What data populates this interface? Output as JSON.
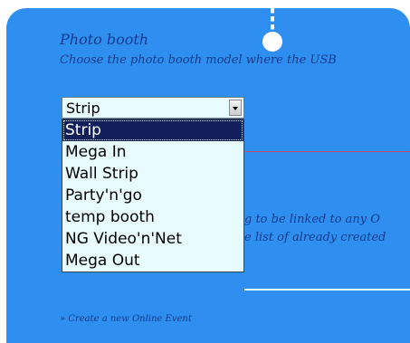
{
  "section": {
    "title": "Photo booth",
    "description": "Choose the photo booth model where the USB"
  },
  "model_select": {
    "value": "Strip",
    "options": [
      "Strip",
      "Mega In",
      "Wall Strip",
      "Party'n'go",
      "temp booth",
      "NG Video'n'Net",
      "Mega Out"
    ],
    "selected_index": 0
  },
  "background_text": {
    "line1": "g to be linked to any O",
    "line2": "e list of already created"
  },
  "create_link": "» Create a new Online Event",
  "colors": {
    "panel": "#2f8ff0",
    "text": "#123a8c",
    "selected_bg": "#11205a",
    "dropdown_bg": "#e8fbff"
  }
}
